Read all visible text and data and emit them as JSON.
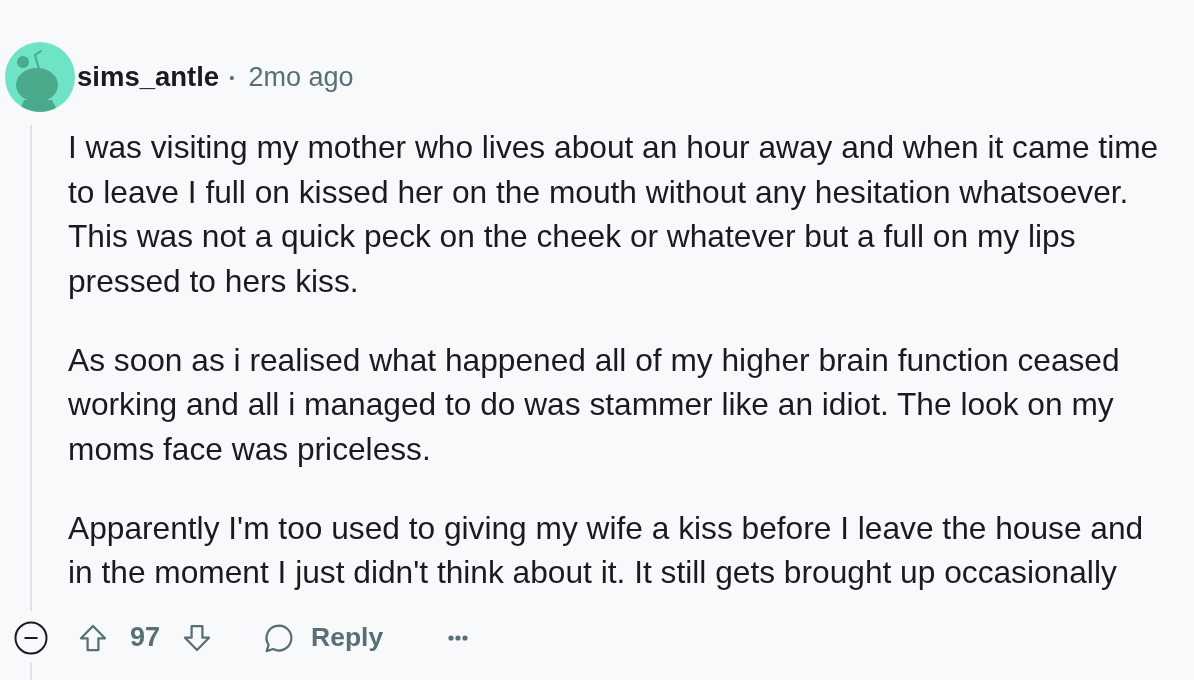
{
  "comment": {
    "author": "sims_antle",
    "separator": "•",
    "time": "2mo ago",
    "paragraphs": [
      "I was visiting my mother who lives about an hour away and when it came time to leave I full on kissed her on the mouth without any hesitation whatsoever. This was not a quick peck on the cheek or whatever but a full on my lips pressed to hers kiss.",
      "As soon as i realised what happened all of my higher brain function ceased working and all i managed to do was stammer like an idiot. The look on my moms face was priceless.",
      "Apparently I'm too used to giving my wife a kiss before I leave the house and in the moment I just didn't think about it. It still gets brought up occasionally"
    ],
    "expanded": true,
    "score": "97",
    "reply_label": "Reply"
  }
}
